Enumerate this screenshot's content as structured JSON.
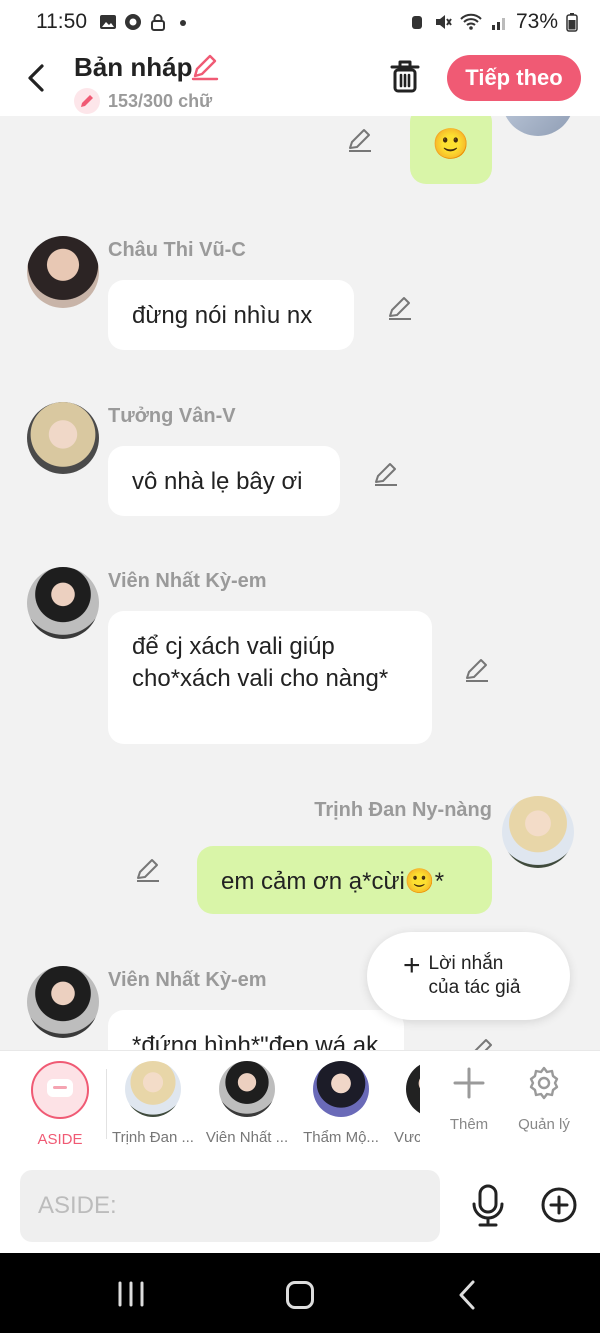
{
  "status": {
    "time": "11:50",
    "battery": "73%"
  },
  "header": {
    "title": "Bản nháp",
    "counter": "153/300 chữ",
    "next_label": "Tiếp theo"
  },
  "messages": [
    {
      "name": "Châu Thi Vũ-C",
      "text": "đừng nói nhìu nx"
    },
    {
      "name": "Tưởng Vân-V",
      "text": "vô nhà lẹ bây ơi"
    },
    {
      "name": "Viên Nhất Kỳ-em",
      "text": "để cj xách vali giúp cho*xách vali cho nàng*"
    },
    {
      "name": "Trịnh Đan Ny-nàng",
      "text": "em cảm ơn ạ*cừi🙂*"
    },
    {
      "name": "Viên Nhất Kỳ-em",
      "text": "*đứng hình*\"đẹp wá ak"
    }
  ],
  "top_emoji": "🙂",
  "author_note": {
    "line1": "Lời nhắn",
    "line2": "của tác giả"
  },
  "charbar": {
    "aside_label": "ASIDE",
    "characters": [
      "Trịnh Đan ...",
      "Viên Nhất ...",
      "Thẩm Mộ...",
      "Vưc"
    ],
    "add_label": "Thêm",
    "manage_label": "Quản lý"
  },
  "input": {
    "placeholder": "ASIDE:"
  },
  "colors": {
    "accent": "#f05a74",
    "me_bubble": "#d9f5a8"
  }
}
